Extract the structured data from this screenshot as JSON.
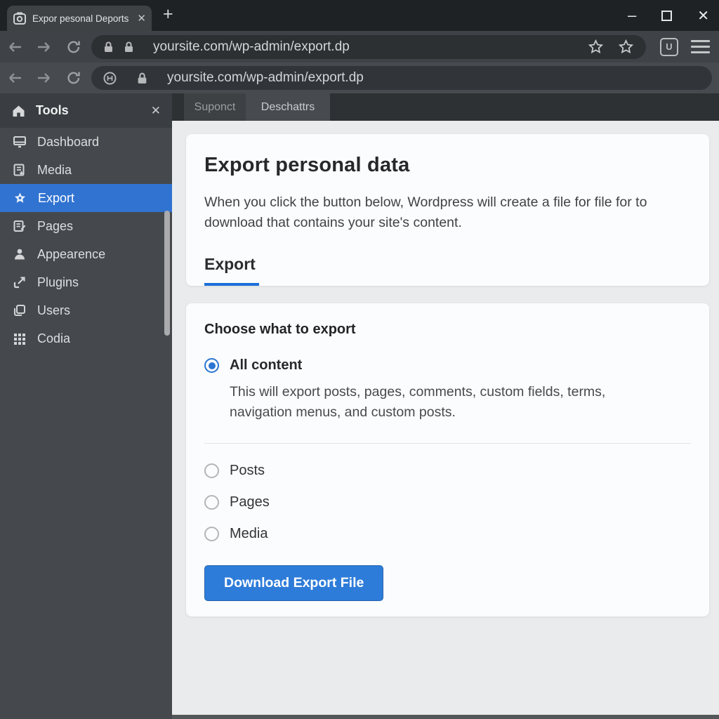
{
  "window": {
    "minimize_label": "–",
    "close_label": "✕"
  },
  "browser": {
    "tab": {
      "title": "Expor pesonal Deports",
      "close_label": "✕"
    },
    "new_tab_label": "+",
    "extension_badge_label": "U",
    "url_row1": {
      "url": "yoursite.com/wp-admin/export.dp"
    },
    "url_row2": {
      "url": "yoursite.com/wp-admin/export.dp"
    }
  },
  "sidebar": {
    "title": "Tools",
    "close_label": "✕",
    "items": [
      {
        "label": "Dashboard",
        "icon": "dashboard-icon",
        "active": false
      },
      {
        "label": "Media",
        "icon": "media-icon",
        "active": false
      },
      {
        "label": "Export",
        "icon": "export-star-icon",
        "active": true
      },
      {
        "label": "Pages",
        "icon": "pages-icon",
        "active": false
      },
      {
        "label": "Appearence",
        "icon": "appearance-icon",
        "active": false
      },
      {
        "label": "Plugins",
        "icon": "plugins-icon",
        "active": false
      },
      {
        "label": "Users",
        "icon": "users-icon",
        "active": false
      },
      {
        "label": "Codia",
        "icon": "grid-icon",
        "active": false
      }
    ],
    "active_color": "#3173d1"
  },
  "content": {
    "tabs": [
      {
        "label": "Suponct"
      },
      {
        "label": "Deschattrs"
      }
    ],
    "export_card": {
      "title": "Export personal data",
      "body": "When you click the button below, Wordpress will create a file for file for to download that contains your site's content.",
      "tab_label": "Export",
      "underline_color": "#1c6fd8"
    },
    "choose_card": {
      "title": "Choose what to export",
      "options": [
        {
          "label": "All content",
          "selected": true,
          "description": "This will export posts, pages, comments, custom fields, terms, navigation menus, and custom posts."
        },
        {
          "label": "Posts",
          "selected": false
        },
        {
          "label": "Pages",
          "selected": false
        },
        {
          "label": "Media",
          "selected": false
        }
      ],
      "button_label": "Download Export File",
      "button_color": "#2e7cd9"
    }
  }
}
